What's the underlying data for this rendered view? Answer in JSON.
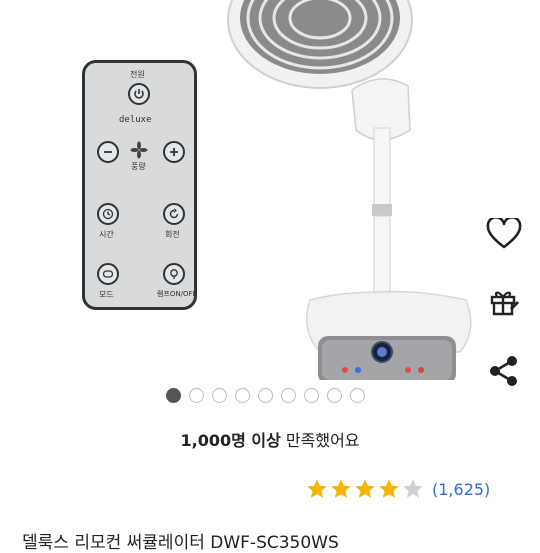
{
  "remote": {
    "brand": "deluxe",
    "power_label": "전원",
    "wind_label": "풍량",
    "timer_label": "시간",
    "rotate_label": "회전",
    "mode_label": "모드",
    "lamp_label": "램프ON/OFF"
  },
  "carousel": {
    "count": 9,
    "active_index": 0
  },
  "satisfaction": {
    "count": "1,000명 이상",
    "suffix": " 만족했어요"
  },
  "rating": {
    "value": 4.0,
    "max": 5,
    "review_count": "(1,625)"
  },
  "product": {
    "title": "델룩스 리모컨 써큘레이터 DWF-SC350WS"
  },
  "icons": {
    "wishlist": "heart-icon",
    "gift": "gift-icon",
    "share": "share-icon",
    "star": "star-icon"
  },
  "colors": {
    "star": "#f5b400",
    "star_empty": "#d0d0d0",
    "link": "#2e6bd6"
  }
}
